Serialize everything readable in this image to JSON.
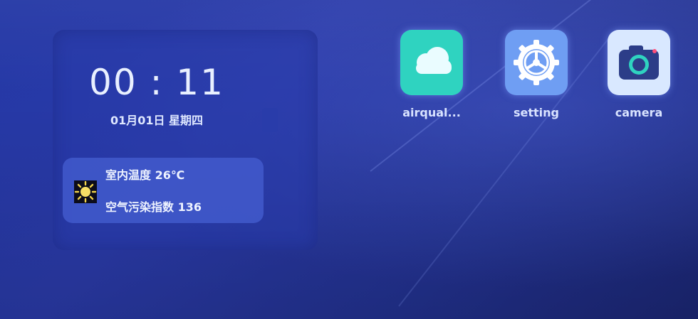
{
  "clock": {
    "time": "00 : 11",
    "date": "01月01日 星期四"
  },
  "weather": {
    "icon": "sun-icon",
    "indoor_temperature": "室内温度 26℃",
    "air_index": "空气污染指数 136"
  },
  "apps": [
    {
      "label": "airqual...",
      "icon": "cloud-icon",
      "color": "#2fd3c0"
    },
    {
      "label": "setting",
      "icon": "gear-icon",
      "color": "#6f9ef3"
    },
    {
      "label": "camera",
      "icon": "camera-icon",
      "color": "#d9e8ff"
    }
  ],
  "colors": {
    "background": "#2438a6",
    "text": "#e9f0ff"
  }
}
